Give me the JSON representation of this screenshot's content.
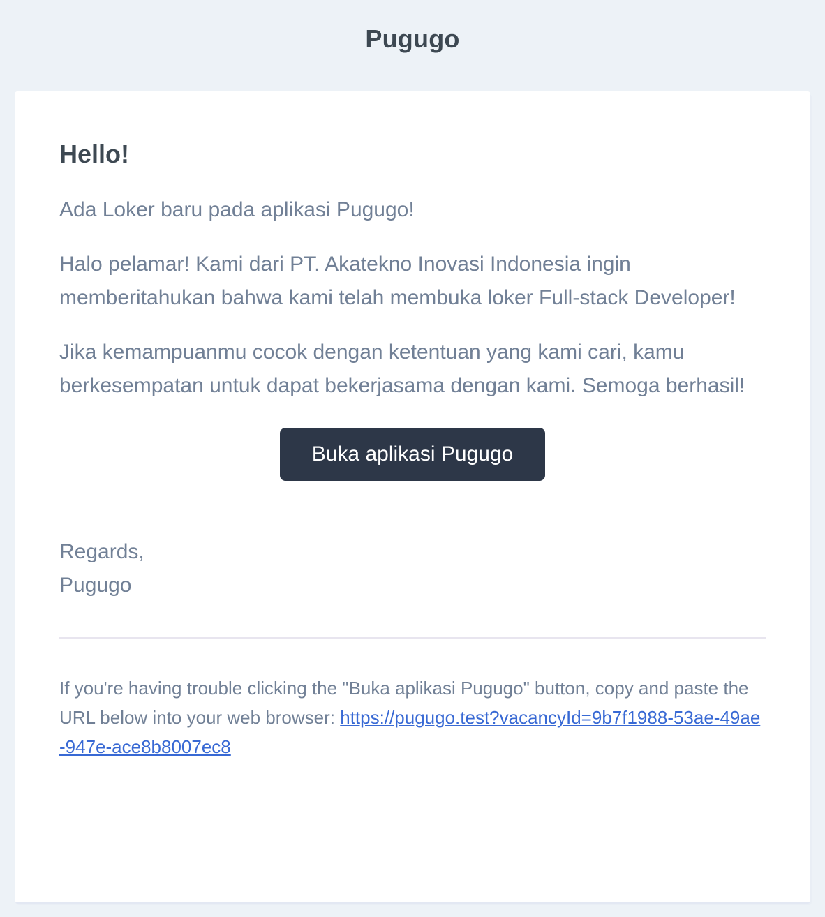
{
  "header": {
    "brand": "Pugugo"
  },
  "email": {
    "greeting": "Hello!",
    "paragraphs": [
      "Ada Loker baru pada aplikasi Pugugo!",
      "Halo pelamar! Kami dari PT. Akatekno Inovasi Indonesia ingin memberitahukan bahwa kami telah membuka loker Full-stack Developer!",
      "Jika kemampuanmu cocok dengan ketentuan yang kami cari, kamu berkesempatan untuk dapat bekerjasama dengan kami. Semoga berhasil!"
    ],
    "action_button": "Buka aplikasi Pugugo",
    "salutation": "Regards,",
    "signature": "Pugugo"
  },
  "subcopy": {
    "text": "If you're having trouble clicking the \"Buka aplikasi Pugugo\" button, copy and paste the URL below into your web browser:",
    "url": "https://pugugo.test?vacancyId=9b7f1988-53ae-49ae-947e-ace8b8007ec8"
  },
  "colors": {
    "background": "#edf2f7",
    "card": "#ffffff",
    "heading": "#3d4852",
    "body_text": "#718096",
    "button": "#2d3748",
    "link": "#3869d4"
  }
}
